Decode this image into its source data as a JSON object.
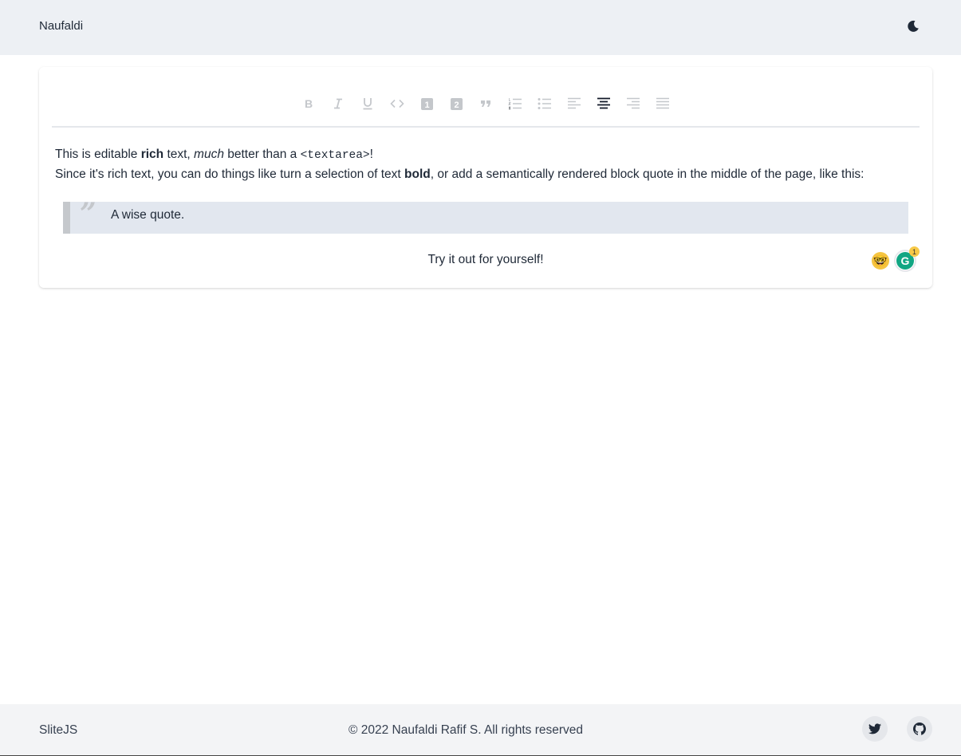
{
  "header": {
    "brand": "Naufaldi",
    "theme_toggle_icon": "moon-icon"
  },
  "toolbar": {
    "buttons": [
      {
        "name": "bold",
        "icon": "bold-icon",
        "active": false
      },
      {
        "name": "italic",
        "icon": "italic-icon",
        "active": false
      },
      {
        "name": "underline",
        "icon": "underline-icon",
        "active": false
      },
      {
        "name": "code",
        "icon": "code-icon",
        "active": false
      },
      {
        "name": "heading-one",
        "icon": "heading-one-icon",
        "active": false
      },
      {
        "name": "heading-two",
        "icon": "heading-two-icon",
        "active": false
      },
      {
        "name": "block-quote",
        "icon": "quote-icon",
        "active": false
      },
      {
        "name": "numbered-list",
        "icon": "numbered-list-icon",
        "active": false
      },
      {
        "name": "bulleted-list",
        "icon": "bulleted-list-icon",
        "active": false
      },
      {
        "name": "align-left",
        "icon": "align-left-icon",
        "active": false
      },
      {
        "name": "align-center",
        "icon": "align-center-icon",
        "active": true
      },
      {
        "name": "align-right",
        "icon": "align-right-icon",
        "active": false
      },
      {
        "name": "align-justify",
        "icon": "align-justify-icon",
        "active": false
      }
    ],
    "h1_glyph": "1",
    "h2_glyph": "2"
  },
  "editor": {
    "line1_a": "This is editable ",
    "line1_bold": "rich",
    "line1_b": " text, ",
    "line1_italic": "much",
    "line1_c": " better than a ",
    "line1_code": "<textarea>",
    "line1_d": "!",
    "line2_a": "Since it's rich text, you can do things like turn a selection of text ",
    "line2_bold": "bold",
    "line2_b": ", or add a semantically rendered block quote in the middle of the page, like this:",
    "quote_mark": "”",
    "quote": "A wise quote.",
    "center_line": "Try it out for yourself!"
  },
  "extensions": {
    "grammarly_letter": "G",
    "grammarly_badge": "1",
    "nerd_emoji": "🤓"
  },
  "footer": {
    "brand": "SliteJS",
    "copyright": "© 2022 Naufaldi Rafif S. All rights reserved"
  },
  "colors": {
    "topbar": "#edf0f4",
    "footer": "#f3f4f6",
    "quote_bg": "#e2e7ef",
    "toolbar_inactive": "#c4c7cb",
    "toolbar_active": "#111827"
  }
}
